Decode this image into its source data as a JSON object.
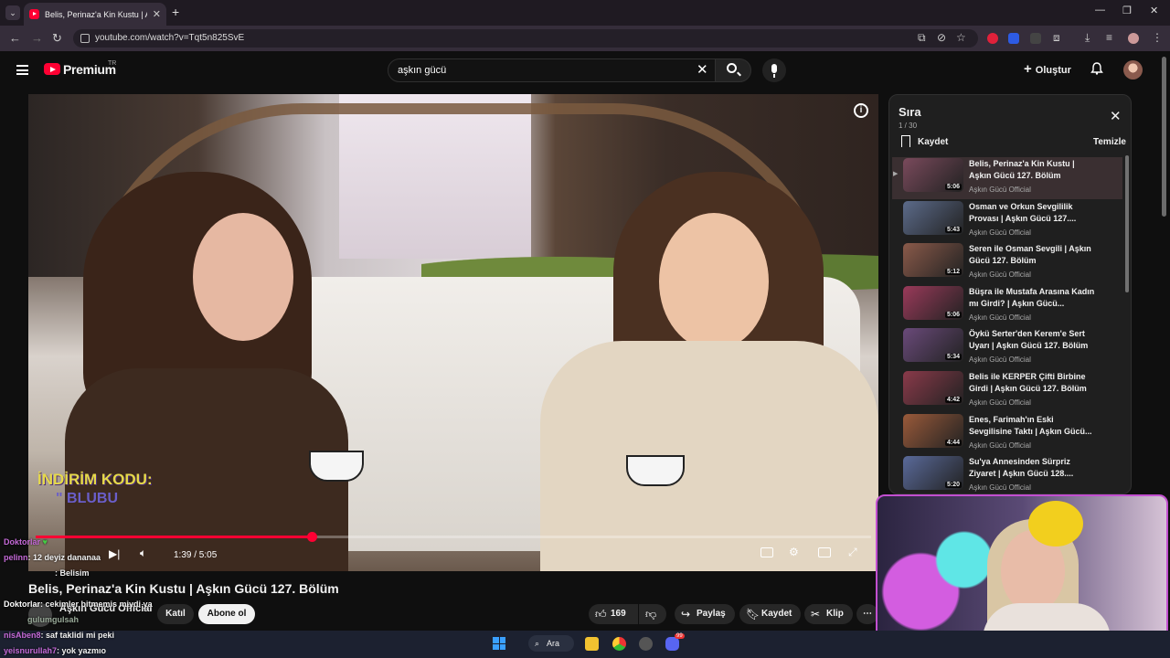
{
  "browser": {
    "tab_title": "Belis, Perinaz'a Kin Kustu | Aşkın Güc",
    "url": "youtube.com/watch?v=Tqt5n825SvE",
    "new_tab": "+",
    "tab_close": "✕"
  },
  "header": {
    "brand": "Premium",
    "region": "TR",
    "search_value": "aşkın gücü",
    "create_label": "Oluştur"
  },
  "player": {
    "current_time": "1:39",
    "duration": "5:05",
    "time_display": "1:39 / 5:05",
    "progress": 0.33,
    "promo_line1": "İNDİRİM KODU:",
    "promo_line2": "\" BLUBU"
  },
  "video": {
    "title": "Belis, Perinaz'a Kin Kustu | Aşkın Gücü 127. Bölüm",
    "channel": "Aşkın Gücü Official",
    "join_label": "Katıl",
    "subscribe_label": "Abone ol",
    "likes": "169",
    "share_label": "Paylaş",
    "save_label": "Kaydet",
    "clip_label": "Klip"
  },
  "playlist": {
    "title": "Sıra",
    "count": "1 / 30",
    "save_label": "Kaydet",
    "clear_label": "Temizle",
    "items": [
      {
        "title": "Belis, Perinaz'a Kin Kustu | Aşkın Gücü 127. Bölüm",
        "channel": "Aşkın Gücü Official",
        "duration": "5:06",
        "thumb": "#7a4a5c"
      },
      {
        "title": "Osman ve Orkun Sevgililik Provası | Aşkın Gücü 127....",
        "channel": "Aşkın Gücü Official",
        "duration": "5:43",
        "thumb": "#5c6b8a"
      },
      {
        "title": "Seren ile Osman Sevgili | Aşkın Gücü 127. Bölüm",
        "channel": "Aşkın Gücü Official",
        "duration": "5:12",
        "thumb": "#8a5a4a"
      },
      {
        "title": "Büşra ile Mustafa Arasına Kadın mı Girdi? | Aşkın Gücü...",
        "channel": "Aşkın Gücü Official",
        "duration": "5:06",
        "thumb": "#9a3a5a"
      },
      {
        "title": "Öykü Serter'den Kerem'e Sert Uyarı | Aşkın Gücü 127. Bölüm",
        "channel": "Aşkın Gücü Official",
        "duration": "5:34",
        "thumb": "#6a4a7a"
      },
      {
        "title": "Belis ile KERPER Çifti Birbine Girdi | Aşkın Gücü 127. Bölüm",
        "channel": "Aşkın Gücü Official",
        "duration": "4:42",
        "thumb": "#8a3a4a"
      },
      {
        "title": "Enes, Farimah'ın Eski Sevgilisine Taktı | Aşkın Gücü...",
        "channel": "Aşkın Gücü Official",
        "duration": "4:44",
        "thumb": "#9a5a3a"
      },
      {
        "title": "Su'ya Annesinden Sürpriz Ziyaret | Aşkın Gücü 128....",
        "channel": "Aşkın Gücü Official",
        "duration": "5:20",
        "thumb": "#5a6a9a"
      }
    ]
  },
  "chat": [
    {
      "name": "Doktorlar",
      "text": "♥"
    },
    {
      "name": "pelinn",
      "text": ": 12 deyiz dananaa"
    },
    {
      "name": "",
      "text": ": Belisim"
    },
    {
      "name": "Doktorlar",
      "text": ": cekimler bitmemis miydi ya"
    },
    {
      "name": "gulumgulsah",
      "text": ""
    },
    {
      "name": "nisAben8",
      "text": ": saf taklidi mi peki"
    },
    {
      "name": "yeisnurullah7",
      "text": ": yok yazmıo"
    }
  ],
  "taskbar": {
    "search_label": "Ara",
    "discord_badge": "99"
  },
  "colors": {
    "accent": "#ff0033",
    "cam_border": "#c24fd0"
  }
}
